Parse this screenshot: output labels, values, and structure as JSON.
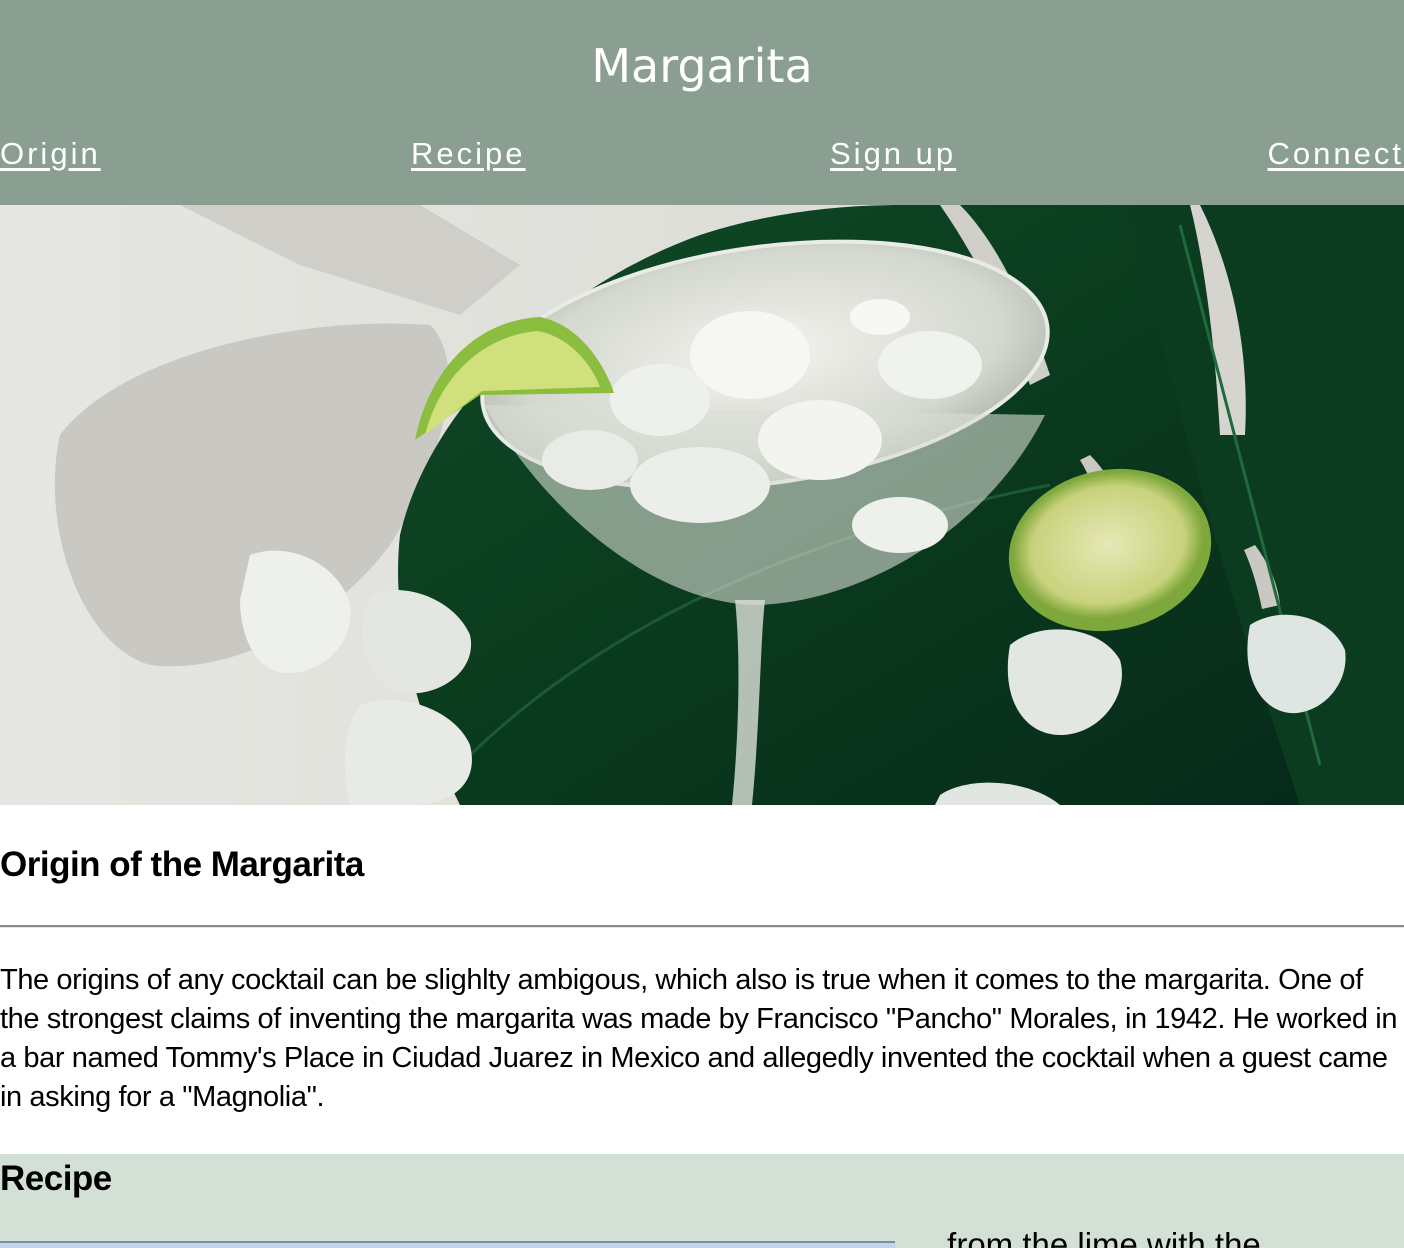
{
  "header": {
    "title": "Margarita",
    "background_color": "#8a9f91",
    "nav": [
      {
        "label": "Origin"
      },
      {
        "label": "Recipe"
      },
      {
        "label": "Sign up"
      },
      {
        "label": "Connect"
      }
    ]
  },
  "hero": {
    "image": "margarita-cocktail-photo"
  },
  "origin": {
    "heading": "Origin of the Margarita",
    "paragraph": "The origins of any cocktail can be slighlty ambigous, which also is true when it comes to the margarita. One of the strongest claims of inventing the margarita was made by Francisco \"Pancho\" Morales, in 1942. He worked in a bar named Tommy's Place in Ciudad Juarez in Mexico and allegedly invented the cocktail when a guest came in asking for a \"Magnolia\"."
  },
  "recipe": {
    "heading": "Recipe",
    "background_color": "#d3e0d6",
    "teaser_text": "… from the lime with the"
  }
}
